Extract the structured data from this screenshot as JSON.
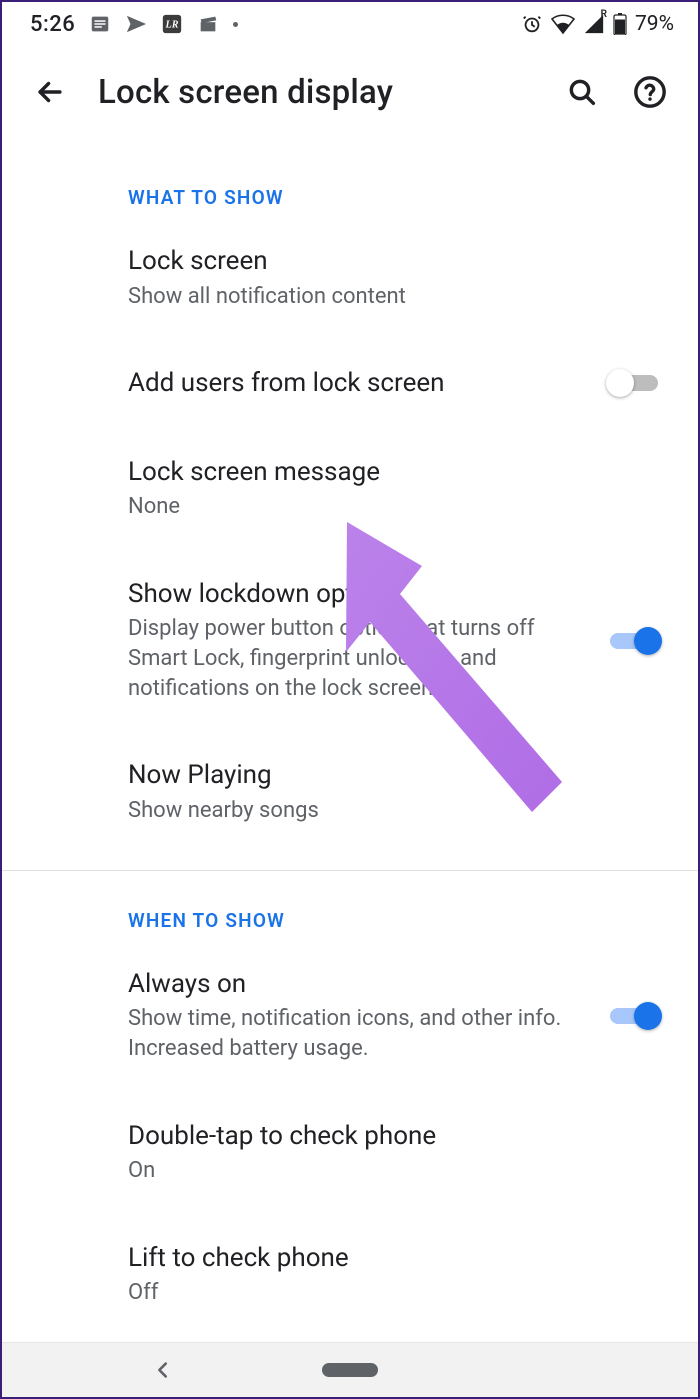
{
  "status": {
    "time": "5:26",
    "battery_text": "79%"
  },
  "header": {
    "title": "Lock screen display"
  },
  "sections": [
    {
      "header": "WHAT TO SHOW",
      "items": [
        {
          "title": "Lock screen",
          "sub": "Show all notification content",
          "toggle": null
        },
        {
          "title": "Add users from lock screen",
          "sub": "",
          "toggle": false
        },
        {
          "title": "Lock screen message",
          "sub": "None",
          "toggle": null
        },
        {
          "title": "Show lockdown option",
          "sub": "Display power button option that turns off Smart Lock, fingerprint unlocking, and notifications on the lock screen",
          "toggle": true
        },
        {
          "title": "Now Playing",
          "sub": "Show nearby songs",
          "toggle": null
        }
      ]
    },
    {
      "header": "WHEN TO SHOW",
      "items": [
        {
          "title": "Always on",
          "sub": "Show time, notification icons, and other info. Increased battery usage.",
          "toggle": true
        },
        {
          "title": "Double-tap to check phone",
          "sub": "On",
          "toggle": null
        },
        {
          "title": "Lift to check phone",
          "sub": "Off",
          "toggle": null
        }
      ]
    }
  ]
}
